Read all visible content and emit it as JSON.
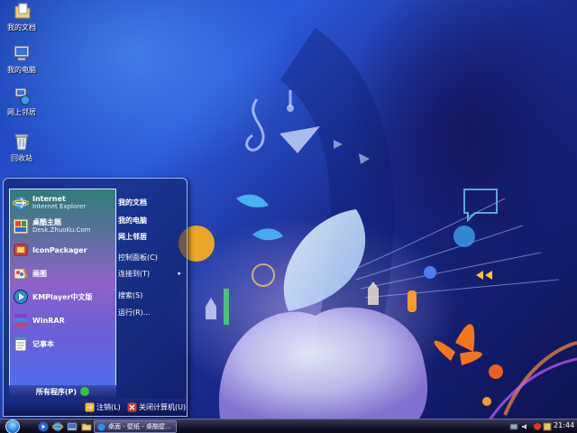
{
  "desktop": {
    "icons": [
      {
        "label": "我的文档",
        "icon": "my-documents-icon"
      },
      {
        "label": "我的电脑",
        "icon": "my-computer-icon"
      },
      {
        "label": "网上邻居",
        "icon": "network-places-icon"
      },
      {
        "label": "回收站",
        "icon": "recycle-bin-icon"
      }
    ]
  },
  "start_menu": {
    "programs": [
      {
        "title": "Internet",
        "subtitle": "Internet Explorer",
        "icon": "internet-explorer-icon"
      },
      {
        "title": "桌酷主题",
        "subtitle": "Desk.ZhuoKu.Com",
        "icon": "theme-icon"
      },
      {
        "title": "IconPackager",
        "subtitle": "",
        "icon": "iconpackager-icon"
      },
      {
        "title": "画图",
        "subtitle": "",
        "icon": "paint-icon"
      },
      {
        "title": "KMPlayer中文版",
        "subtitle": "",
        "icon": "kmplayer-icon"
      },
      {
        "title": "WinRAR",
        "subtitle": "",
        "icon": "winrar-icon"
      },
      {
        "title": "记事本",
        "subtitle": "",
        "icon": "notepad-icon"
      }
    ],
    "all_programs": "所有程序(P)",
    "places": [
      {
        "label": "我的文档"
      },
      {
        "label": "我的电脑"
      },
      {
        "label": "网上邻居"
      },
      {
        "label": "控制面板(C)"
      },
      {
        "label": "连接到(T)",
        "submenu_arrow": "▸"
      },
      {
        "label": "搜索(S)"
      },
      {
        "label": "运行(R)..."
      }
    ],
    "logoff": "注销(L)",
    "shutdown": "关闭计算机(U)"
  },
  "taskbar": {
    "task_button_label": "桌面 - 壁纸 - 桌酷壁...",
    "clock": "21:44"
  },
  "colors": {
    "accent": "#2a58d8",
    "taskbar": "#14142a"
  }
}
